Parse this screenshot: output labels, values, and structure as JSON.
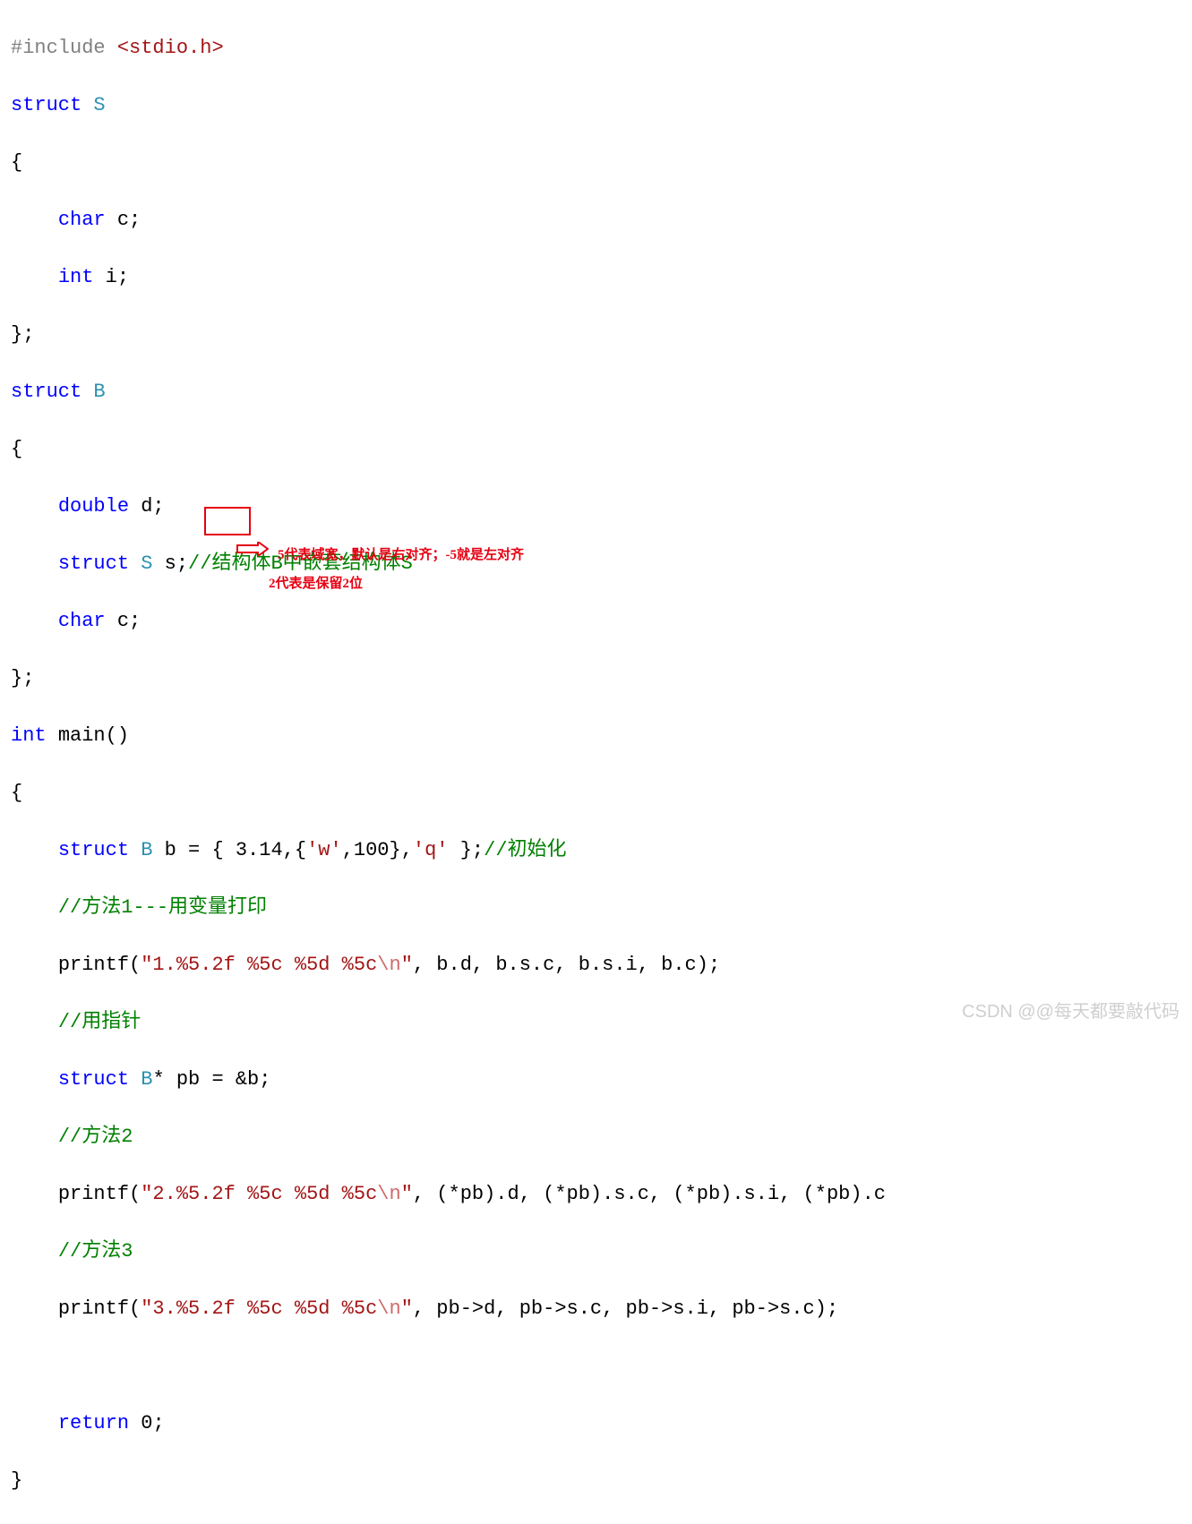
{
  "code": {
    "l1": {
      "include": "#include ",
      "hdr": "<stdio.h>"
    },
    "l2": {
      "kw": "struct ",
      "name": "S"
    },
    "l3": "{",
    "l4": {
      "kw": "char ",
      "id": "c;"
    },
    "l5": {
      "kw": "int ",
      "id": "i;"
    },
    "l6": "};",
    "l7": {
      "kw": "struct ",
      "name": "B"
    },
    "l8": "{",
    "l9": {
      "kw": "double ",
      "id": "d;"
    },
    "l10": {
      "kw": "struct ",
      "name": "S",
      "id": " s;",
      "comment": "//结构体B中嵌套结构体S"
    },
    "l11": {
      "kw": "char ",
      "id": "c;"
    },
    "l12": "};",
    "l13": {
      "kw": "int ",
      "id": "main()"
    },
    "l14": "{",
    "l15": {
      "kw": "struct ",
      "name": "B",
      "id": " b = { ",
      "num1": "3.14",
      "comma1": ",{",
      "ch1": "'w'",
      "comma2": ",",
      "num2": "100",
      "close1": "},",
      "ch2": "'q'",
      "close2": " };",
      "comment": "//初始化"
    },
    "l16": {
      "comment": "//方法1---用变量打印"
    },
    "l17": {
      "call": "printf(",
      "str_a": "\"1.%",
      "str_boxed": "5.2",
      "str_b": "f %5c %5d %5c",
      "esc": "\\n",
      "str_c": "\"",
      "rest": ", b.d, b.s.c, b.s.i, b.c);"
    },
    "l18": {
      "comment": "//用指针"
    },
    "l19": {
      "kw": "struct ",
      "name": "B",
      "rest": "* pb = &b;"
    },
    "l20": {
      "comment": "//方法2"
    },
    "l21": {
      "call": "printf(",
      "str_a": "\"2.%5.2f %5c %5d %5c",
      "esc": "\\n",
      "str_c": "\"",
      "rest": ", (*pb).d, (*pb).s.c, (*pb).s.i, (*pb).c"
    },
    "l22": {
      "comment": "//方法3"
    },
    "l23": {
      "call": "printf(",
      "str_a": "\"3.%5.2f %5c %5d %5c",
      "esc": "\\n",
      "str_c": "\"",
      "rest": ", pb->d, pb->s.c, pb->s.i, pb->s.c);"
    },
    "l24": "",
    "l25": {
      "kw": "return ",
      "num": "0",
      "semi": ";"
    },
    "l26": "}"
  },
  "annotations": {
    "a1": "5代表域宽，默认是右对齐；-5就是左对齐",
    "a2": "2代表是保留2位"
  },
  "watermark": "CSDN @@每天都要敲代码"
}
